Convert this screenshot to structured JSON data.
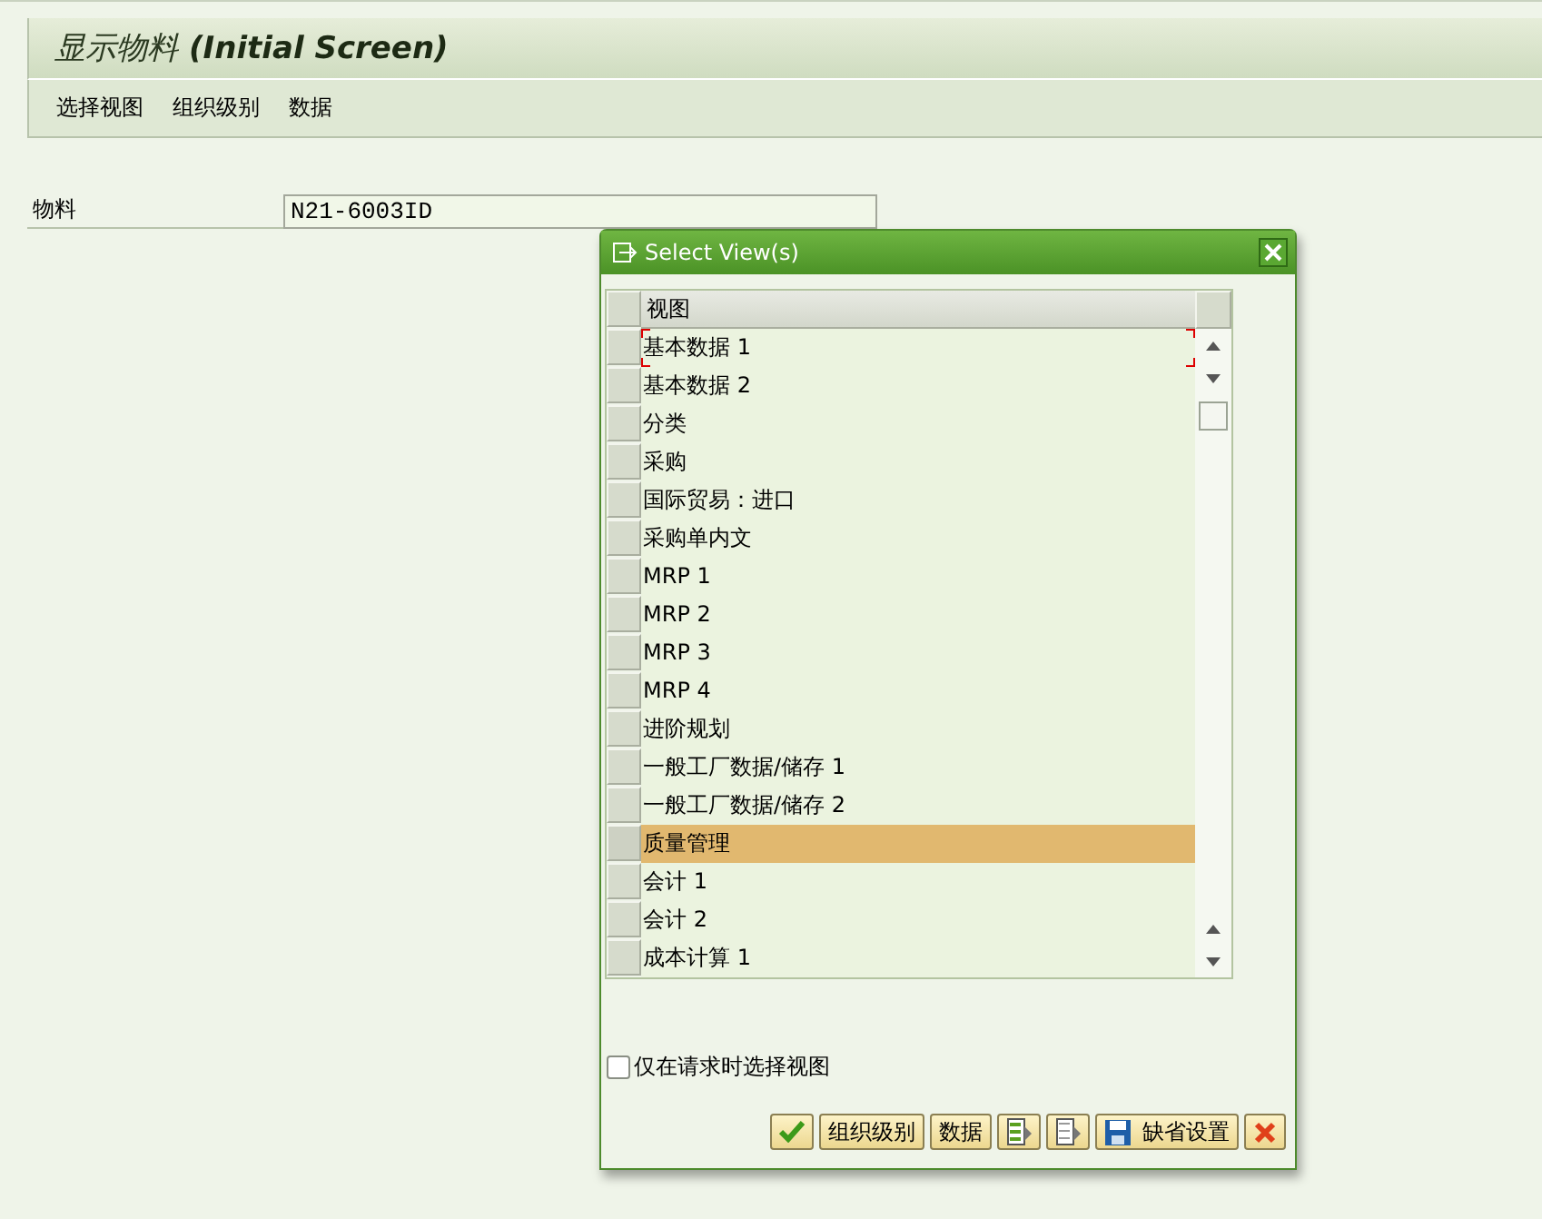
{
  "screen": {
    "title": "显示物料",
    "title_suffix": "(Initial Screen)"
  },
  "menu": [
    "选择视图",
    "组织级别",
    "数据"
  ],
  "material": {
    "label": "物料",
    "value": "N21-6003ID"
  },
  "dialog": {
    "title": "Select View(s)",
    "column": "视图",
    "rows": [
      {
        "label": "基本数据 1",
        "selected": false,
        "focused": true
      },
      {
        "label": "基本数据 2",
        "selected": false,
        "focused": false
      },
      {
        "label": "分类",
        "selected": false,
        "focused": false
      },
      {
        "label": "采购",
        "selected": false,
        "focused": false
      },
      {
        "label": "国际贸易：进口",
        "selected": false,
        "focused": false
      },
      {
        "label": "采购单内文",
        "selected": false,
        "focused": false
      },
      {
        "label": "MRP 1",
        "selected": false,
        "focused": false
      },
      {
        "label": "MRP 2",
        "selected": false,
        "focused": false
      },
      {
        "label": "MRP 3",
        "selected": false,
        "focused": false
      },
      {
        "label": "MRP 4",
        "selected": false,
        "focused": false
      },
      {
        "label": "进阶规划",
        "selected": false,
        "focused": false
      },
      {
        "label": "一般工厂数据/储存 1",
        "selected": false,
        "focused": false
      },
      {
        "label": "一般工厂数据/储存 2",
        "selected": false,
        "focused": false
      },
      {
        "label": "质量管理",
        "selected": true,
        "focused": false
      },
      {
        "label": "会计 1",
        "selected": false,
        "focused": false
      },
      {
        "label": "会计 2",
        "selected": false,
        "focused": false
      },
      {
        "label": "成本计算 1",
        "selected": false,
        "focused": false
      }
    ],
    "checkbox": {
      "label": "仅在请求时选择视图",
      "checked": false
    },
    "buttons": [
      {
        "kind": "confirm"
      },
      {
        "kind": "text",
        "label": "组织级别"
      },
      {
        "kind": "text",
        "label": "数据"
      },
      {
        "kind": "select-all"
      },
      {
        "kind": "deselect-all"
      },
      {
        "kind": "save",
        "label": "缺省设置"
      },
      {
        "kind": "cancel"
      }
    ]
  }
}
